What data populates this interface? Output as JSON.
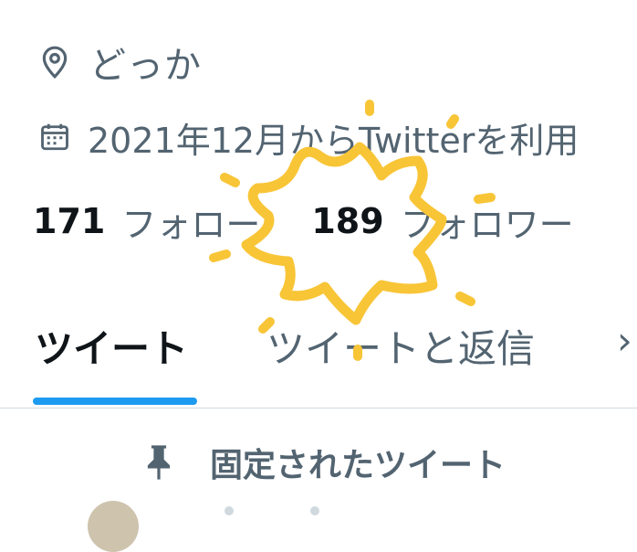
{
  "profile": {
    "location": "どっか",
    "joined": "2021年12月からTwitterを利用",
    "following_count": "171",
    "following_label": "フォロー",
    "followers_count": "189",
    "followers_label": "フォロワー"
  },
  "tabs": [
    {
      "label": "ツイート",
      "selected": true
    },
    {
      "label": "ツイートと返信",
      "selected": false
    },
    {
      "label": "›",
      "selected": false
    }
  ],
  "pinned": {
    "label": "固定されたツイート"
  },
  "icons": {
    "location": "location-pin-icon",
    "calendar": "calendar-icon",
    "pin": "pin-icon",
    "sticker": "starburst-sticker"
  },
  "colors": {
    "accent": "#1d9bf0",
    "primary_text": "#0f1419",
    "secondary_text": "#536471",
    "sticker": "#f8c537"
  }
}
